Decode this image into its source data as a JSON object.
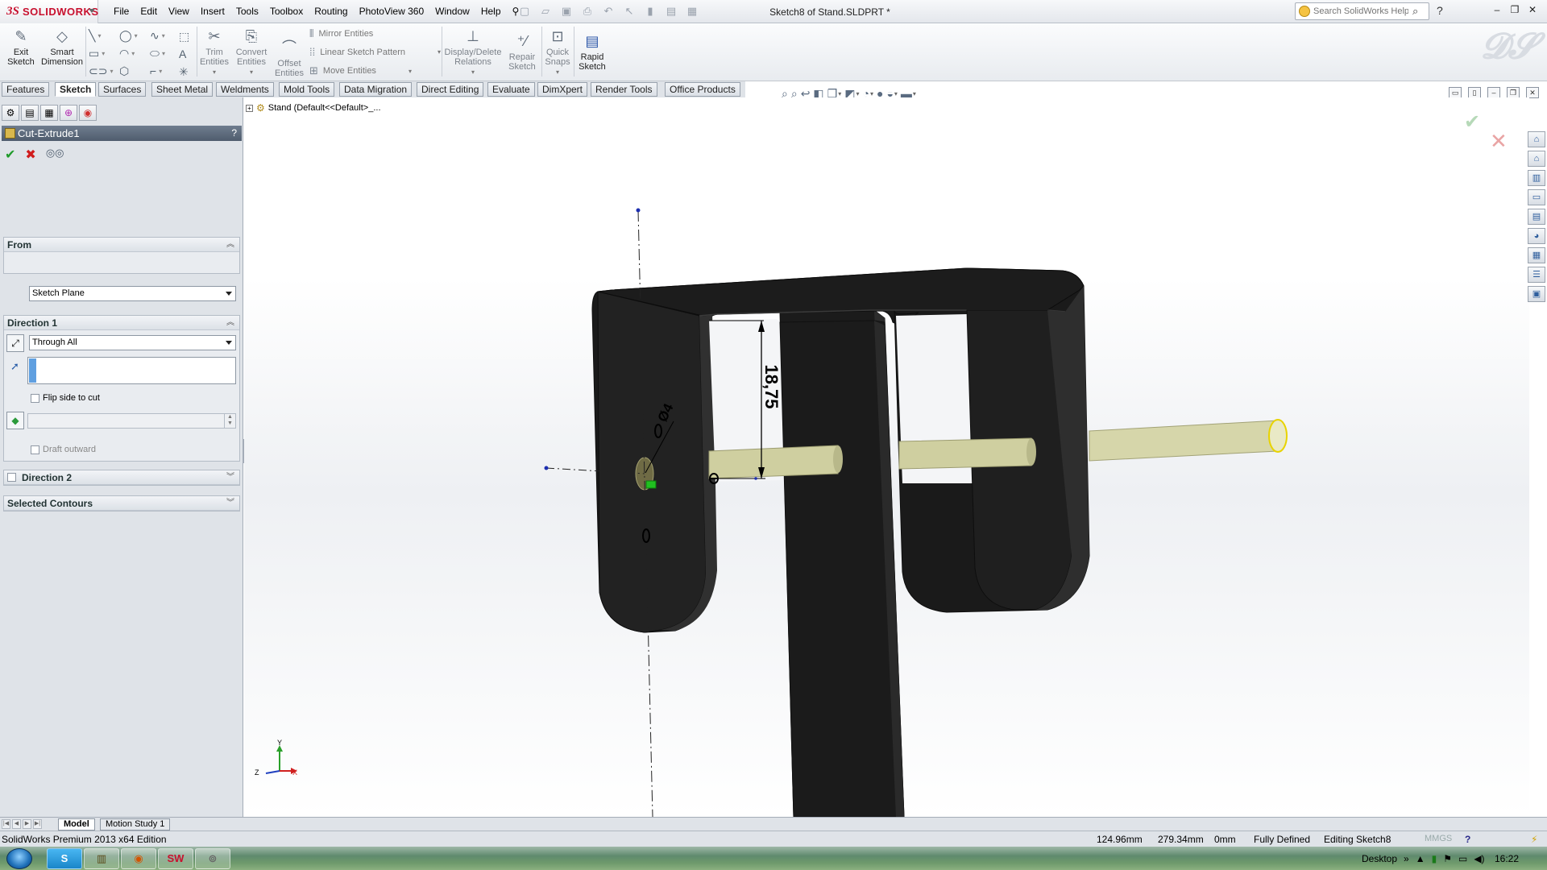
{
  "app": {
    "logo_ds": "3S",
    "logo_text": "SOLIDWORKS",
    "document_title": "Sketch8 of Stand.SLDPRT *"
  },
  "menus": [
    "File",
    "Edit",
    "View",
    "Insert",
    "Tools",
    "Toolbox",
    "Routing",
    "PhotoView 360",
    "Window",
    "Help"
  ],
  "search": {
    "placeholder": "Search SolidWorks Help"
  },
  "commands": {
    "exit_sketch": "Exit\nSketch",
    "smart_dimension": "Smart\nDimension",
    "trim_entities": "Trim\nEntities",
    "convert_entities": "Convert\nEntities",
    "offset_entities": "Offset\nEntities",
    "mirror_entities": "Mirror Entities",
    "linear_sketch_pattern": "Linear Sketch Pattern",
    "move_entities": "Move Entities",
    "display_delete_relations": "Display/Delete\nRelations",
    "repair_sketch": "Repair\nSketch",
    "quick_snaps": "Quick\nSnaps",
    "rapid_sketch": "Rapid\nSketch"
  },
  "tabs": [
    "Features",
    "Sketch",
    "Surfaces",
    "Sheet Metal",
    "Weldments",
    "Mold Tools",
    "Data Migration",
    "Direct Editing",
    "Evaluate",
    "DimXpert",
    "Render Tools",
    "Office Products"
  ],
  "active_tab": "Sketch",
  "property_manager": {
    "title": "Cut-Extrude1",
    "help_symbol": "?",
    "from": {
      "header": "From",
      "value": "Sketch Plane"
    },
    "direction1": {
      "header": "Direction 1",
      "end_condition": "Through All",
      "flip_side": "Flip side to cut",
      "draft_outward": "Draft outward"
    },
    "direction2": {
      "header": "Direction 2"
    },
    "selected_contours": {
      "header": "Selected Contours"
    }
  },
  "tree_flyout": {
    "label": "Stand  (Default<<Default>_..."
  },
  "sketch": {
    "dimension_vertical": "18,75",
    "dimension_diameter": "Ø4"
  },
  "triad": {
    "x": "X",
    "y": "Y",
    "z": "Z"
  },
  "model_tabs": [
    "Model",
    "Motion Study 1"
  ],
  "active_model_tab": "Model",
  "status": {
    "edition": "SolidWorks Premium 2013 x64 Edition",
    "x": "124.96mm",
    "y": "279.34mm",
    "z": "0mm",
    "state": "Fully Defined",
    "editing": "Editing Sketch8",
    "units": "MMGS"
  },
  "taskbar": {
    "desktop_label": "Desktop",
    "time": "16:22",
    "apps": [
      "skype",
      "file-manager",
      "firefox",
      "solidworks",
      "other"
    ]
  },
  "colors": {
    "accent_blue": "#5f9fe0",
    "ok_green": "#1f9b2a",
    "cancel_red": "#d01c1c",
    "part_black": "#1b1b1b",
    "shaft_khaki": "#cfcfa0"
  }
}
